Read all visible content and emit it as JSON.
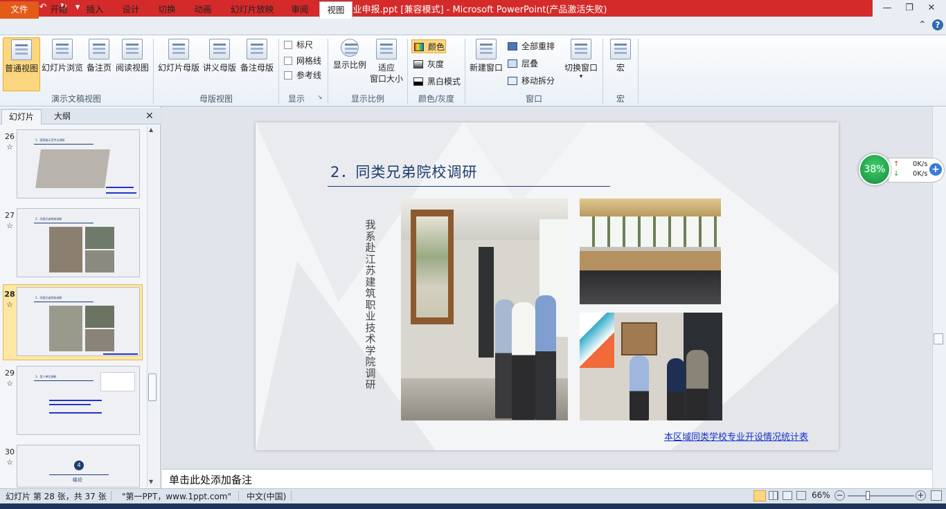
{
  "app": {
    "title": "新专业申报.ppt [兼容模式]  -  Microsoft PowerPoint(产品激活失败)",
    "quick_access": {
      "save": "💾",
      "undo": "↶",
      "redo": "↻",
      "customize": "▾"
    },
    "window": {
      "minimize": "—",
      "restore": "❐",
      "close": "✕"
    }
  },
  "tabs": [
    {
      "label": "文件"
    },
    {
      "label": "开始"
    },
    {
      "label": "插入"
    },
    {
      "label": "设计"
    },
    {
      "label": "切换"
    },
    {
      "label": "动画"
    },
    {
      "label": "幻灯片放映"
    },
    {
      "label": "审阅"
    },
    {
      "label": "视图"
    }
  ],
  "ribbon_right": {
    "collapse": "⌃",
    "help": "?"
  },
  "ribbon": {
    "presentation_views": {
      "label": "演示文稿视图",
      "buttons": [
        "普通视图",
        "幻灯片浏览",
        "备注页",
        "阅读视图"
      ]
    },
    "master_views": {
      "label": "母版视图",
      "buttons": [
        "幻灯片母版",
        "讲义母版",
        "备注母版"
      ]
    },
    "show": {
      "label": "显示",
      "checkboxes": [
        "标尺",
        "网格线",
        "参考线"
      ],
      "launcher": "↘"
    },
    "zoom": {
      "label": "显示比例",
      "zoom_button": "显示比例",
      "fit_line1": "适应",
      "fit_line2": "窗口大小"
    },
    "color": {
      "label": "颜色/灰度",
      "options": [
        "颜色",
        "灰度",
        "黑白模式"
      ]
    },
    "window": {
      "label": "窗口",
      "new_window": "新建窗口",
      "arrange_all": "全部重排",
      "cascade": "层叠",
      "move_split": "移动拆分",
      "switch_windows": "切换窗口",
      "switch_arrow": "▾"
    },
    "macros": {
      "label": "宏",
      "button": "宏"
    }
  },
  "left_pane": {
    "tabs": [
      "幻灯片",
      "大纲"
    ],
    "close": "✕",
    "slides": [
      {
        "num": "26",
        "title": "1．国家级示范专业调研"
      },
      {
        "num": "27",
        "title": "2．同类兄弟院校调研"
      },
      {
        "num": "28",
        "title": "2．同类兄弟院校调研"
      },
      {
        "num": "29",
        "title": "3．用人单位调研"
      },
      {
        "num": "30",
        "badge": "4",
        "title": "结论"
      }
    ],
    "star": "☆",
    "scroll_up": "▲",
    "scroll_down": "▼"
  },
  "slide": {
    "title": "2．同类兄弟院校调研",
    "vertical_text": "我系赴江苏建筑职业技术学院调研",
    "link": "本区域同类学校专业开设情况统计表"
  },
  "notes": {
    "placeholder": "单击此处添加备注"
  },
  "speed_widget": {
    "percent": "38%",
    "up": "0K/s",
    "down": "0K/s",
    "up_arrow": "↑",
    "down_arrow": "↓",
    "plus": "+"
  },
  "status": {
    "slide_info": "幻灯片 第 28 张，共 37 张",
    "theme": "\"第一PPT，www.1ppt.com\"",
    "language": "中文(中国)",
    "zoom": "66%",
    "zoom_out": "−",
    "zoom_in": "+"
  },
  "colors": {
    "titlebar": "#d42a2a",
    "file_tab": "#e45a19",
    "accent_blue": "#1d3c6e",
    "selection": "#fde7a4"
  }
}
